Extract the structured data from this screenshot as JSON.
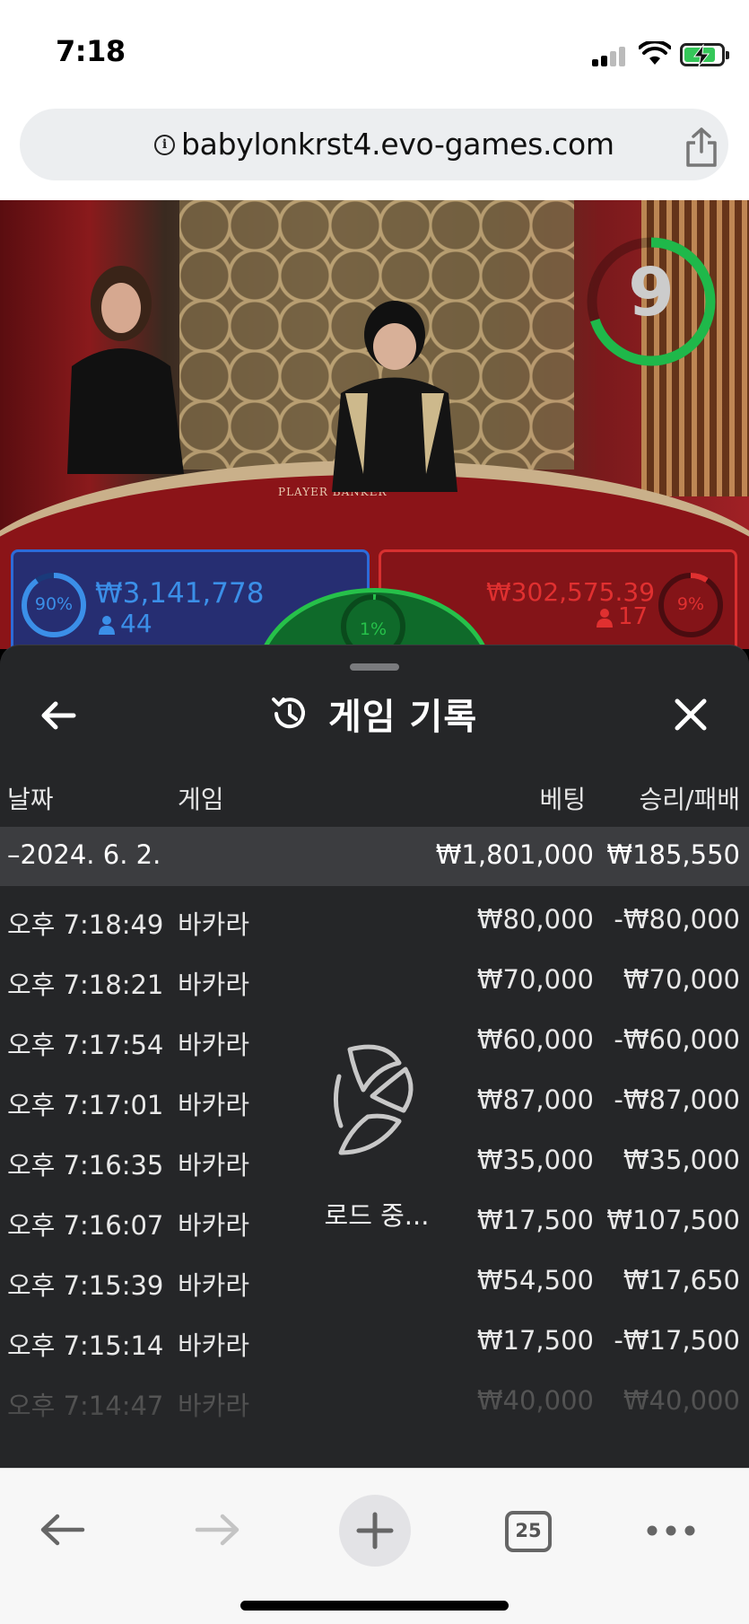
{
  "status_bar": {
    "time": "7:18",
    "battery_state": "charging",
    "signal_icon": "cellular-signal-icon",
    "wifi_icon": "wifi-icon"
  },
  "browser": {
    "url": "babylonkrst4.evo-games.com",
    "info_icon": "info-icon",
    "share_icon": "share-icon"
  },
  "game_stream": {
    "countdown": "9",
    "player_pct": "90%",
    "player_amount": "₩3,141,778",
    "player_count": "44",
    "tie_pct": "1%",
    "banker_amount": "₩302,575.39",
    "banker_count": "17",
    "banker_pct": "9%",
    "table_text": "PLAYER    BANKER",
    "colors": {
      "player": "#3b8fe8",
      "banker": "#e03030",
      "tie": "#26c14a"
    }
  },
  "history": {
    "title": "게임 기록",
    "back_icon": "back-arrow-icon",
    "close_icon": "close-icon",
    "columns": {
      "date": "날짜",
      "game": "게임",
      "bet": "베팅",
      "win_loss": "승리/패배"
    },
    "date_group": {
      "date": "–2024. 6. 2.",
      "total_bet": "₩1,801,000",
      "total_win_loss": "₩185,550"
    },
    "rows": [
      {
        "time": "오후 7:18:49",
        "game": "바카라",
        "bet": "₩80,000",
        "result": "-₩80,000"
      },
      {
        "time": "오후 7:18:21",
        "game": "바카라",
        "bet": "₩70,000",
        "result": "₩70,000"
      },
      {
        "time": "오후 7:17:54",
        "game": "바카라",
        "bet": "₩60,000",
        "result": "-₩60,000"
      },
      {
        "time": "오후 7:17:01",
        "game": "바카라",
        "bet": "₩87,000",
        "result": "-₩87,000"
      },
      {
        "time": "오후 7:16:35",
        "game": "바카라",
        "bet": "₩35,000",
        "result": "₩35,000"
      },
      {
        "time": "오후 7:16:07",
        "game": "바카라",
        "bet": "₩17,500",
        "result": "₩107,500"
      },
      {
        "time": "오후 7:15:39",
        "game": "바카라",
        "bet": "₩54,500",
        "result": "₩17,650"
      },
      {
        "time": "오후 7:15:14",
        "game": "바카라",
        "bet": "₩17,500",
        "result": "-₩17,500"
      },
      {
        "time": "오후 7:14:47",
        "game": "바카라",
        "bet": "₩40,000",
        "result": "₩40,000"
      }
    ],
    "loading_text": "로드 중..."
  },
  "toolbar": {
    "tab_count": "25",
    "back_icon": "back-icon",
    "forward_icon": "forward-icon",
    "new_tab_icon": "plus-icon",
    "more_icon": "more-icon"
  }
}
